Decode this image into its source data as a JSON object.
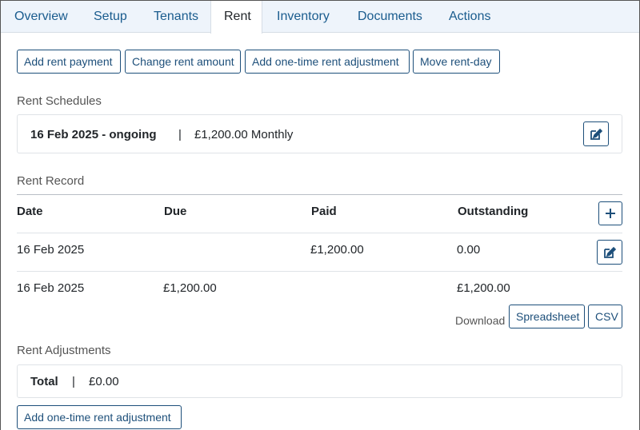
{
  "tabs": [
    {
      "label": "Overview"
    },
    {
      "label": "Setup"
    },
    {
      "label": "Tenants"
    },
    {
      "label": "Rent"
    },
    {
      "label": "Inventory"
    },
    {
      "label": "Documents"
    },
    {
      "label": "Actions"
    }
  ],
  "toolbar": {
    "add_payment": "Add rent payment",
    "change_amount": "Change rent amount",
    "add_adjustment": "Add one-time rent adjustment",
    "move_rent_day": "Move rent-day"
  },
  "schedules": {
    "title": "Rent Schedules",
    "period": "16 Feb 2025 - ongoing",
    "separator": "|",
    "amount": "£1,200.00 Monthly",
    "edit_icon": "edit-icon"
  },
  "record": {
    "title": "Rent Record",
    "headers": {
      "date": "Date",
      "due": "Due",
      "paid": "Paid",
      "outstanding": "Outstanding"
    },
    "add_icon": "plus-icon",
    "rows": [
      {
        "date": "16 Feb 2025",
        "due": "",
        "paid": "£1,200.00",
        "outstanding": "0.00"
      },
      {
        "date": "16 Feb 2025",
        "due": "£1,200.00",
        "paid": "",
        "outstanding": "£1,200.00"
      }
    ],
    "download_label": "Download",
    "spreadsheet_label": "Spreadsheet",
    "csv_label": "CSV"
  },
  "adjustments": {
    "title": "Rent Adjustments",
    "total_label": "Total",
    "separator": "|",
    "total_value": "£0.00",
    "add_button": "Add one-time rent adjustment"
  },
  "colors": {
    "accent": "#1d4f7a",
    "tab_bar": "#eef4fb",
    "border": "#dfe3e7"
  }
}
